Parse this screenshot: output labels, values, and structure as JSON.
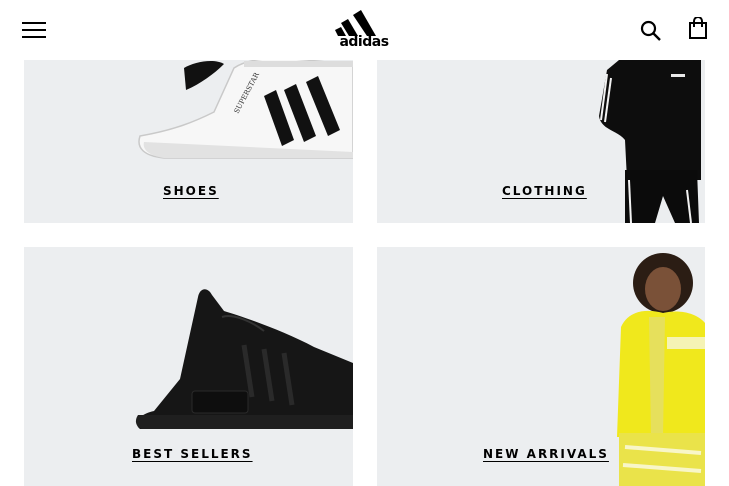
{
  "header": {
    "brand": "adidas",
    "menu_icon": "hamburger-menu-icon",
    "search_icon": "search-icon",
    "bag_icon": "shopping-bag-icon"
  },
  "tiles": [
    {
      "label": "SHOES",
      "image": "superstar-sneaker"
    },
    {
      "label": "CLOTHING",
      "image": "black-track-suit"
    },
    {
      "label": "BEST SELLERS",
      "image": "black-nmd-sneaker"
    },
    {
      "label": "NEW ARRIVALS",
      "image": "yellow-track-suit-model"
    }
  ],
  "product_print": {
    "shoe_model": "SUPERSTAR"
  },
  "colors": {
    "tile_bg": "#eceef0",
    "text": "#000000",
    "accent_yellow": "#f0e81c"
  }
}
